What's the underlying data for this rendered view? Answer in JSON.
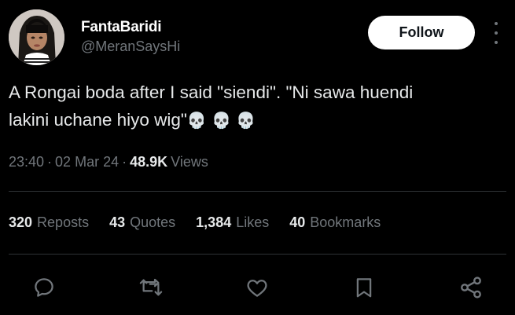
{
  "author": {
    "display_name": "FantaBaridi",
    "handle": "@MeranSaysHi",
    "avatar_icon": "user-avatar-photo"
  },
  "header": {
    "follow_label": "Follow",
    "more_icon": "more-vertical-icon"
  },
  "tweet": {
    "text_line1": "A Rongai boda after I said \"siendi\". \"Ni sawa huendi",
    "text_line2": "lakini uchane hiyo wig\"",
    "emojis": "💀 💀 💀",
    "time": "23:40",
    "separator": "·",
    "date": "02 Mar 24",
    "views_count": "48.9K",
    "views_label": "Views"
  },
  "stats": [
    {
      "count": "320",
      "label": "Reposts"
    },
    {
      "count": "43",
      "label": "Quotes"
    },
    {
      "count": "1,384",
      "label": "Likes"
    },
    {
      "count": "40",
      "label": "Bookmarks"
    }
  ],
  "actions": [
    {
      "icon": "reply-icon"
    },
    {
      "icon": "repost-icon"
    },
    {
      "icon": "like-icon"
    },
    {
      "icon": "bookmark-icon"
    },
    {
      "icon": "share-icon"
    }
  ],
  "colors": {
    "background": "#000000",
    "primary_text": "#e7e9ea",
    "secondary_text": "#71767b",
    "divider": "#2f3336",
    "follow_button_bg": "#ffffff"
  }
}
